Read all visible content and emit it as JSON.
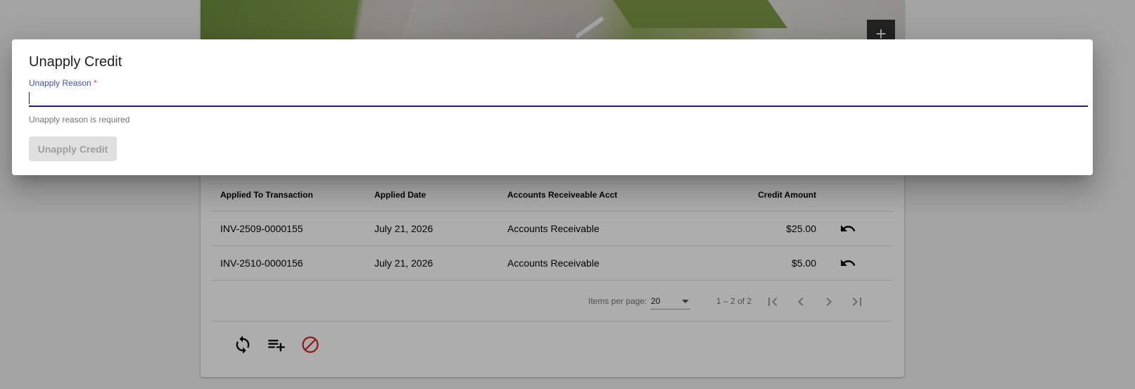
{
  "background": {
    "zoom_label": "+",
    "table": {
      "headers": [
        "Applied To Transaction",
        "Applied Date",
        "Accounts Receiveable Acct",
        "Credit Amount"
      ],
      "rows": [
        [
          "INV-2509-0000155",
          "July 21, 2026",
          "Accounts Receivable",
          "$25.00"
        ],
        [
          "INV-2510-0000156",
          "July 21, 2026",
          "Accounts Receivable",
          "$5.00"
        ]
      ]
    },
    "paginator": {
      "items_per_page_label": "Items per page:",
      "items_per_page_value": "20",
      "range_label": "1 – 2 of 2"
    }
  },
  "dialog": {
    "title": "Unapply Credit",
    "field_label": "Unapply Reason",
    "required_mark": "*",
    "field_value": "",
    "hint": "Unapply reason is required",
    "button_label": "Unapply Credit"
  },
  "colors": {
    "accent": "#1a237e",
    "label": "#3f51b5",
    "required": "#f44336",
    "block_icon": "#d32f2f"
  }
}
